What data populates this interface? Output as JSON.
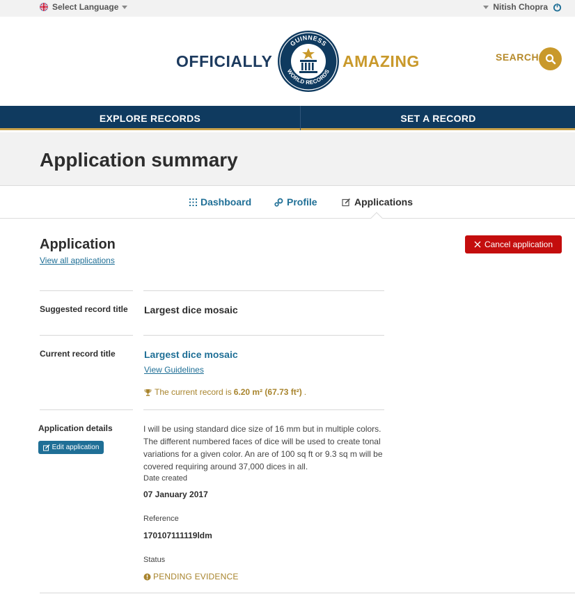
{
  "topbar": {
    "language_label": "Select Language",
    "user_name": "Nitish Chopra"
  },
  "header": {
    "brand_left": "OFFICIALLY",
    "brand_right": "AMAZING",
    "search_label": "SEARCH",
    "logo_arc_text": "GUINNESS WORLD RECORDS"
  },
  "nav": {
    "items": [
      {
        "label": "EXPLORE RECORDS"
      },
      {
        "label": "SET A RECORD"
      }
    ]
  },
  "page": {
    "title": "Application summary"
  },
  "subnav": {
    "items": [
      {
        "label": "Dashboard",
        "icon": "grid-icon"
      },
      {
        "label": "Profile",
        "icon": "gears-icon"
      },
      {
        "label": "Applications",
        "icon": "edit-icon",
        "active": true
      }
    ]
  },
  "application": {
    "heading": "Application",
    "view_all_link": "View all applications",
    "cancel_button": "Cancel application",
    "suggested_title_label": "Suggested record title",
    "suggested_title_value": "Largest dice mosaic",
    "current_title_label": "Current record title",
    "current_title_value": "Largest dice mosaic",
    "guidelines_link": "View Guidelines",
    "current_record_prefix": "The current record is",
    "current_record_value": "6.20 m² (67.73 ft²)",
    "current_record_suffix": ".",
    "details_label": "Application details",
    "edit_button": "Edit application",
    "description": "I will be using standard dice size of 16 mm but in multiple colors. The different numbered faces of dice will be used to create tonal variations for a given color. An are of 100 sq ft or 9.3 sq m will be covered requiring around 37,000 dices in all.",
    "date_created_label": "Date created",
    "date_created_value": "07 January 2017",
    "reference_label": "Reference",
    "reference_value": "170107111119ldm",
    "status_label": "Status",
    "status_value": "PENDING EVIDENCE"
  },
  "colors": {
    "navy": "#0f3a5f",
    "gold": "#c9992b",
    "link_blue": "#1f6f96",
    "cancel_red": "#c40d0d"
  }
}
